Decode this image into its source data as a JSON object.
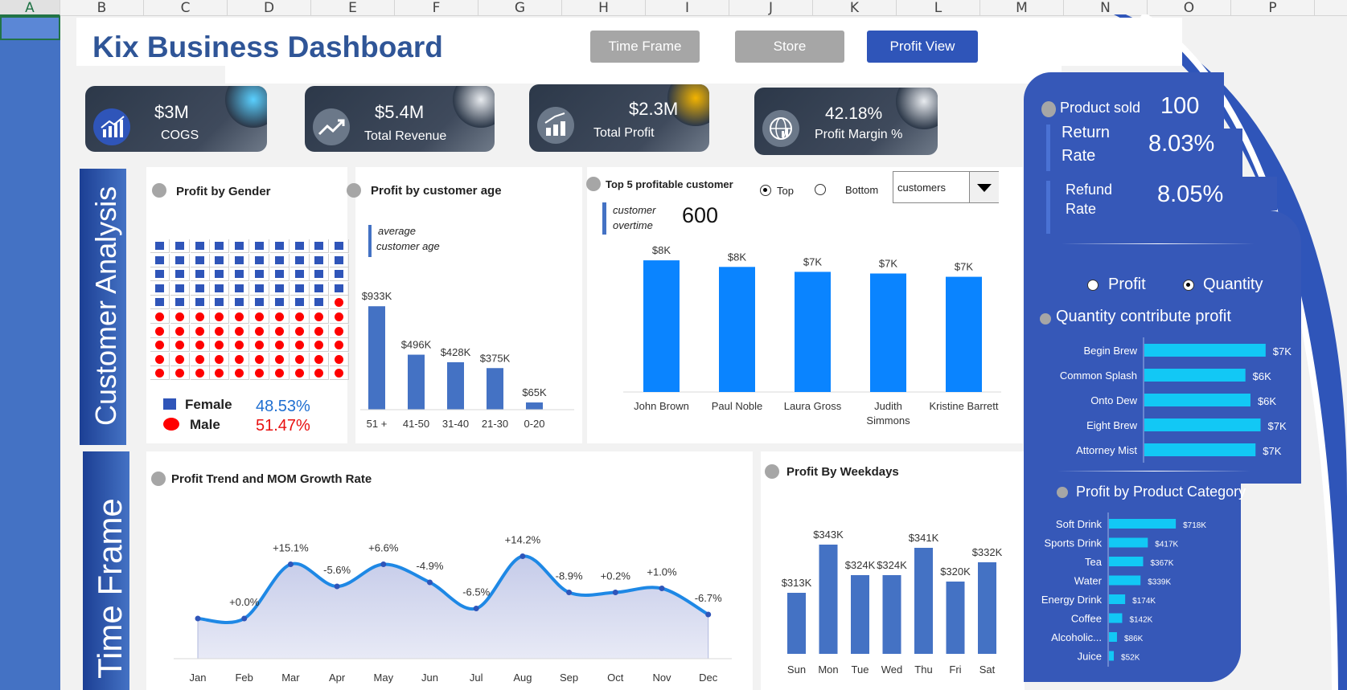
{
  "spreadsheet": {
    "columns": [
      "A",
      "B",
      "C",
      "D",
      "E",
      "F",
      "G",
      "H",
      "I",
      "J",
      "K",
      "L",
      "M",
      "N",
      "O",
      "P"
    ]
  },
  "header": {
    "title": "Kix Business Dashboard",
    "nav": [
      "Time Frame",
      "Store",
      "Profit View"
    ]
  },
  "kpis": [
    {
      "value": "$3M",
      "label": "COGS",
      "icon": "chart-up-icon"
    },
    {
      "value": "$5.4M",
      "label": "Total Revenue",
      "icon": "trend-line-icon"
    },
    {
      "value": "$2.3M",
      "label": "Total Profit",
      "icon": "growth-bars-icon"
    },
    {
      "value": "42.18%",
      "label": "Profit Margin %",
      "icon": "globe-chart-icon"
    }
  ],
  "sections": {
    "customer_analysis": "Customer Analysis",
    "time_frame": "Time Frame"
  },
  "gender": {
    "title": "Profit by Gender",
    "female_label": "Female",
    "male_label": "Male",
    "female_pct": "48.53%",
    "male_pct": "51.47%"
  },
  "age": {
    "title": "Profit by customer age",
    "note_line1": "average",
    "note_line2": "customer age"
  },
  "top5": {
    "title": "Top 5 profitable  customer",
    "radio_top": "Top",
    "radio_bottom": "Bottom",
    "dropdown_value": "customers",
    "overtime_line1": "customer",
    "overtime_line2": "overtime",
    "overtime_value": "600"
  },
  "trend": {
    "title": "Profit  Trend  and MOM Growth Rate"
  },
  "weekdays": {
    "title": "Profit  By Weekdays"
  },
  "right_panel": {
    "product_sold_label": "Product sold",
    "product_sold_value": "100",
    "return_rate_line1": "Return",
    "return_rate_line2": "Rate",
    "return_rate_value": "8.03%",
    "refund_rate_line1": "Refund",
    "refund_rate_line2": "Rate",
    "refund_rate_value": "8.05%",
    "radio_profit": "Profit",
    "radio_quantity": "Quantity",
    "qty_title": "Quantity contribute profit",
    "cat_title": "Profit by Product Category"
  },
  "colors": {
    "brand_blue": "#2f55b9",
    "bar_blue": "#4472c4",
    "bright_blue": "#0a84ff",
    "cyan": "#12c8f5",
    "male_red": "#ff0000",
    "female_pct_color": "#1f6fd1",
    "male_pct_color": "#e81010"
  },
  "chart_data": [
    {
      "type": "bar",
      "id": "age",
      "categories": [
        "51 +",
        "41-50",
        "31-40",
        "21-30",
        "0-20"
      ],
      "values": [
        933,
        496,
        428,
        375,
        65
      ],
      "labels": [
        "$933K",
        "$496K",
        "$428K",
        "$375K",
        "$65K"
      ],
      "ylim": [
        0,
        1000
      ]
    },
    {
      "type": "bar",
      "id": "top5",
      "categories": [
        "John Brown",
        "Paul Noble",
        "Laura Gross",
        "Judith Simmons",
        "Kristine Barrett"
      ],
      "values": [
        8,
        7.6,
        7.3,
        7.2,
        7.0
      ],
      "labels": [
        "$8K",
        "$8K",
        "$7K",
        "$7K",
        "$7K"
      ],
      "ylim": [
        0,
        8.2
      ]
    },
    {
      "type": "area",
      "id": "trend",
      "categories": [
        "Jan",
        "Feb",
        "Mar",
        "Apr",
        "May",
        "Jun",
        "Jul",
        "Aug",
        "Sep",
        "Oct",
        "Nov",
        "Dec"
      ],
      "values": [
        180,
        180,
        207,
        196,
        207,
        198,
        185,
        211,
        193,
        193,
        195,
        182
      ],
      "growth_labels": [
        "",
        "+0.0%",
        "+15.1%",
        "-5.6%",
        "+6.6%",
        "-4.9%",
        "-6.5%",
        "+14.2%",
        "-8.9%",
        "+0.2%",
        "+1.0%",
        "-6.7%"
      ],
      "ylim": [
        160,
        220
      ]
    },
    {
      "type": "bar",
      "id": "weekdays",
      "categories": [
        "Sun",
        "Mon",
        "Tue",
        "Wed",
        "Thu",
        "Fri",
        "Sat"
      ],
      "values": [
        313,
        343,
        324,
        324,
        341,
        320,
        332
      ],
      "labels": [
        "$313K",
        "$343K",
        "$324K",
        "$324K",
        "$341K",
        "$320K",
        "$332K"
      ],
      "ylim": [
        290,
        350
      ]
    },
    {
      "type": "bar",
      "id": "qty",
      "orientation": "horizontal",
      "categories": [
        "Begin Brew",
        "Common Splash",
        "Onto Dew",
        "Eight Brew",
        "Attorney Mist"
      ],
      "values": [
        7.2,
        6.0,
        6.3,
        6.9,
        6.6
      ],
      "labels": [
        "$7K",
        "$6K",
        "$6K",
        "$7K",
        "$7K"
      ],
      "xlim": [
        0,
        7.4
      ]
    },
    {
      "type": "bar",
      "id": "category",
      "orientation": "horizontal",
      "categories": [
        "Soft Drink",
        "Sports Drink",
        "Tea",
        "Water",
        "Energy Drink",
        "Coffee",
        "Alcoholic...",
        "Juice"
      ],
      "values": [
        718,
        417,
        367,
        339,
        174,
        142,
        86,
        52
      ],
      "labels": [
        "$718K",
        "$417K",
        "$367K",
        "$339K",
        "$174K",
        "$142K",
        "$86K",
        "$52K"
      ],
      "xlim": [
        0,
        760
      ]
    }
  ]
}
